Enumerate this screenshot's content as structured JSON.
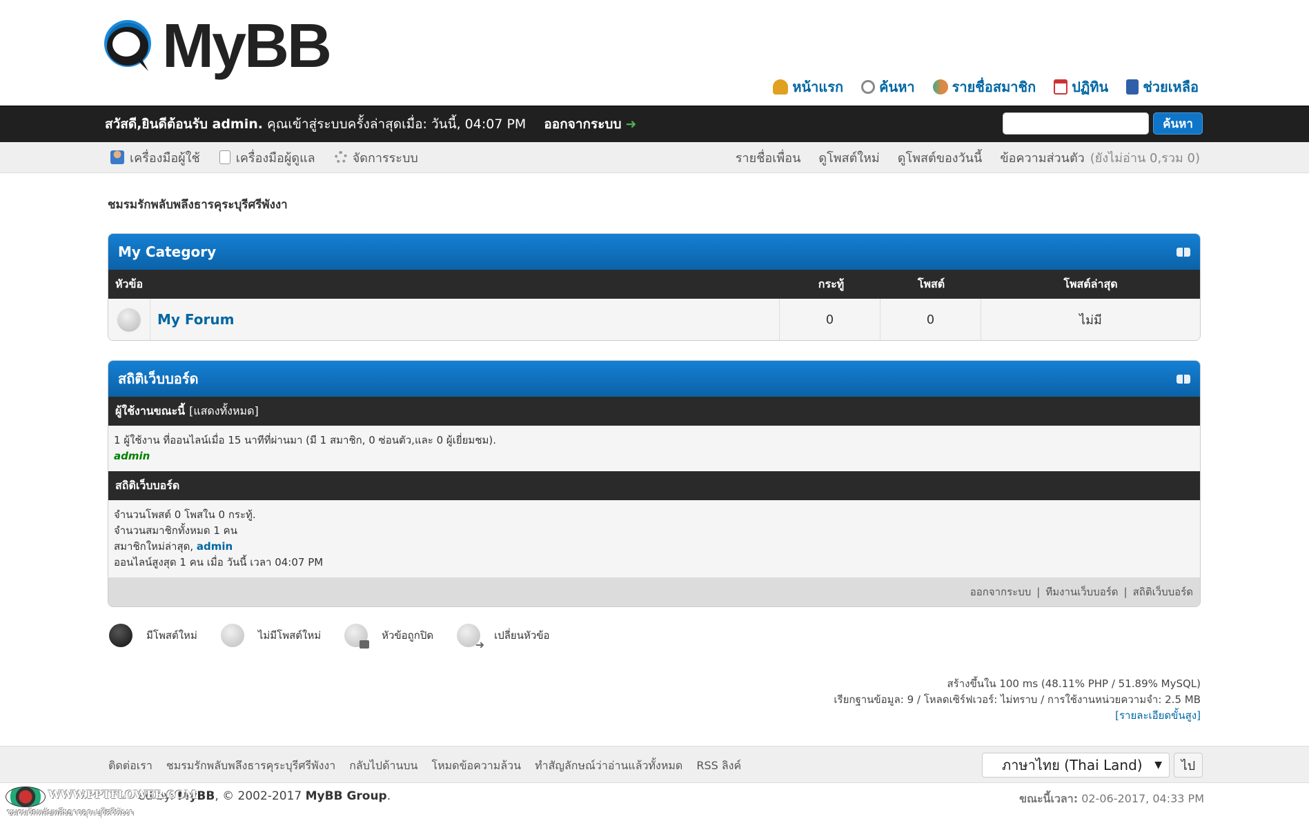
{
  "header": {
    "logo_text": "MyBB",
    "links": [
      {
        "label": "หน้าแรก",
        "icon": "bell-icon"
      },
      {
        "label": "ค้นหา",
        "icon": "search-icon"
      },
      {
        "label": "รายชื่อสมาชิก",
        "icon": "members-icon"
      },
      {
        "label": "ปฏิทิน",
        "icon": "calendar-icon"
      },
      {
        "label": "ช่วยเหลือ",
        "icon": "help-icon"
      }
    ]
  },
  "welcome": {
    "greeting": "สวัสดี,ยินดีต้อนรับ admin.",
    "last_visit": " คุณเข้าสู่ระบบครั้งล่าสุดเมื่อ: วันนี้, 04:07 PM",
    "logout": "ออกจากระบบ",
    "search_button": "ค้นหา"
  },
  "subnav": {
    "left": [
      {
        "label": "เครื่องมือผู้ใช้"
      },
      {
        "label": "เครื่องมือผู้ดูแล"
      },
      {
        "label": "จัดการระบบ"
      }
    ],
    "right": [
      {
        "label": "รายชื่อเพื่อน"
      },
      {
        "label": "ดูโพสต์ใหม่"
      },
      {
        "label": "ดูโพสต์ของวันนี้"
      },
      {
        "label": "ข้อความส่วนตัว",
        "muted": "(ยังไม่อ่าน 0,รวม 0)"
      }
    ]
  },
  "board_title": "ชมรมรักพลับพลึงธารคุระบุรีศรีพังงา",
  "category": {
    "title": "My Category",
    "columns": {
      "subject": "หัวข้อ",
      "threads": "กระทู้",
      "posts": "โพสต์",
      "last_post": "โพสต์ล่าสุด"
    },
    "forums": [
      {
        "name": "My Forum",
        "threads": "0",
        "posts": "0",
        "last_post": "ไม่มี"
      }
    ]
  },
  "stats": {
    "title": "สถิติเว็บบอร์ด",
    "online_head": "ผู้ใช้งานขณะนี้",
    "online_show_all": "[แสดงทั้งหมด]",
    "online_text": "1 ผู้ใช้งาน ที่ออนไลน์เมื่อ 15 นาทีที่ผ่านมา (มี 1 สมาชิก, 0 ซ่อนตัว,และ 0 ผู้เยี่ยมชม).",
    "online_user": "admin",
    "stats_head": "สถิติเว็บบอร์ด",
    "line1": "จำนวนโพสต์ 0 โพสใน 0 กระทู้.",
    "line2": "จำนวนสมาชิกทั้งหมด 1 คน",
    "line3_prefix": "สมาชิกใหม่ล่าสุด, ",
    "line3_user": "admin",
    "line4": "ออนไลน์สูงสุด 1 คน เมื่อ วันนี้ เวลา 04:07 PM",
    "footer_links": [
      "ออกจากระบบ",
      "ทีมงานเว็บบอร์ด",
      "สถิติเว็บบอร์ด"
    ],
    "footer_sep": "|"
  },
  "legend": [
    {
      "label": "มีโพสต์ใหม่"
    },
    {
      "label": "ไม่มีโพสต์ใหม่"
    },
    {
      "label": "หัวข้อถูกปิด"
    },
    {
      "label": "เปลี่ยนหัวข้อ"
    }
  ],
  "debug": {
    "line1": "สร้างขึ้นใน 100 ms (48.11% PHP / 51.89% MySQL)",
    "line2": "เรียกฐานข้อมูล: 9 / โหลดเซิร์ฟเวอร์: ไม่ทราบ / การใช้งานหน่วยความจำ: 2.5 MB",
    "advanced": "[รายละเอียดขั้นสูง]"
  },
  "bottom_nav": {
    "links": [
      "ติดต่อเรา",
      "ชมรมรักพลับพลึงธารคุระบุรีศรีพังงา",
      "กลับไปด้านบน",
      "โหมดข้อความล้วน",
      "ทำสัญลักษณ์ว่าอ่านแล้วทั้งหมด",
      "RSS ลิงค์"
    ],
    "language": "ภาษาไทย (Thai Land)",
    "go": "ไป"
  },
  "footer": {
    "powered_prefix": "ed by: ",
    "powered_mybb": "MyBB",
    "copyright": ", © 2002-2017 ",
    "group": "MyBB Group",
    "dot": ".",
    "time_label": "ขณะนี้เวลา:",
    "time_value": " 02-06-2017, 04:33 PM"
  },
  "watermark": {
    "url": "WWW.PPTFLOWER.COM",
    "sub": "ชมรมรักพลับพลึงธารคุระบุรีศรีพังงา"
  },
  "colors": {
    "accent": "#0f75c8",
    "link": "#0066a2",
    "bar": "#202020"
  }
}
